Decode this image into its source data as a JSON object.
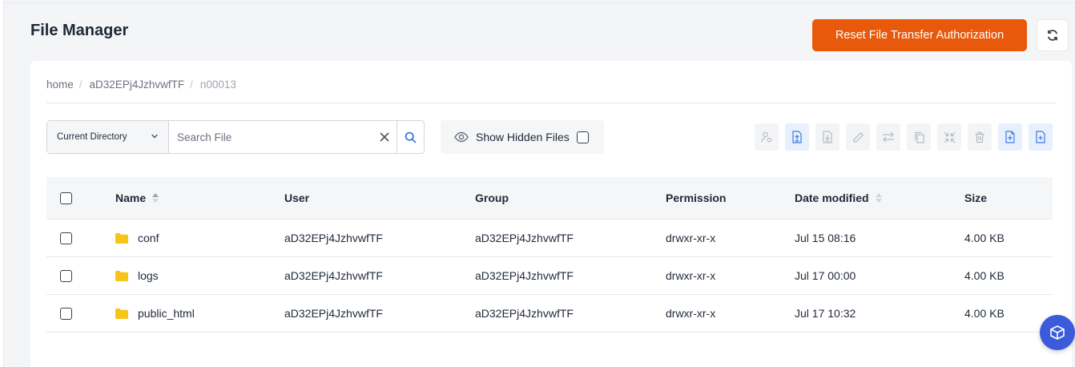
{
  "page": {
    "title": "File Manager"
  },
  "actions": {
    "reset_label": "Reset File Transfer Authorization"
  },
  "breadcrumb": {
    "home": "home",
    "mid": "aD32EPj4JzhvwfTF",
    "last": "n00013"
  },
  "search": {
    "scope_label": "Current Directory",
    "placeholder": "Search File",
    "value": ""
  },
  "hidden_files": {
    "label": "Show Hidden Files",
    "checked": false
  },
  "toolbar": {
    "tools": [
      "user-permission-icon",
      "upload-file-icon",
      "download-file-icon",
      "edit-icon",
      "move-icon",
      "copy-icon",
      "compress-icon",
      "delete-icon",
      "new-folder-icon",
      "new-file-icon"
    ]
  },
  "table": {
    "headers": {
      "name": "Name",
      "user": "User",
      "group": "Group",
      "permission": "Permission",
      "date": "Date modified",
      "size": "Size"
    },
    "rows": [
      {
        "name": "conf",
        "user": "aD32EPj4JzhvwfTF",
        "group": "aD32EPj4JzhvwfTF",
        "permission": "drwxr-xr-x",
        "date": "Jul 15 08:16",
        "size": "4.00 KB"
      },
      {
        "name": "logs",
        "user": "aD32EPj4JzhvwfTF",
        "group": "aD32EPj4JzhvwfTF",
        "permission": "drwxr-xr-x",
        "date": "Jul 17 00:00",
        "size": "4.00 KB"
      },
      {
        "name": "public_html",
        "user": "aD32EPj4JzhvwfTF",
        "group": "aD32EPj4JzhvwfTF",
        "permission": "drwxr-xr-x",
        "date": "Jul 17 10:32",
        "size": "4.00 KB"
      }
    ]
  },
  "colors": {
    "accent": "#e8590c",
    "primary": "#3b7ddd",
    "folder": "#f5c518",
    "fab": "#3b5bdb"
  }
}
